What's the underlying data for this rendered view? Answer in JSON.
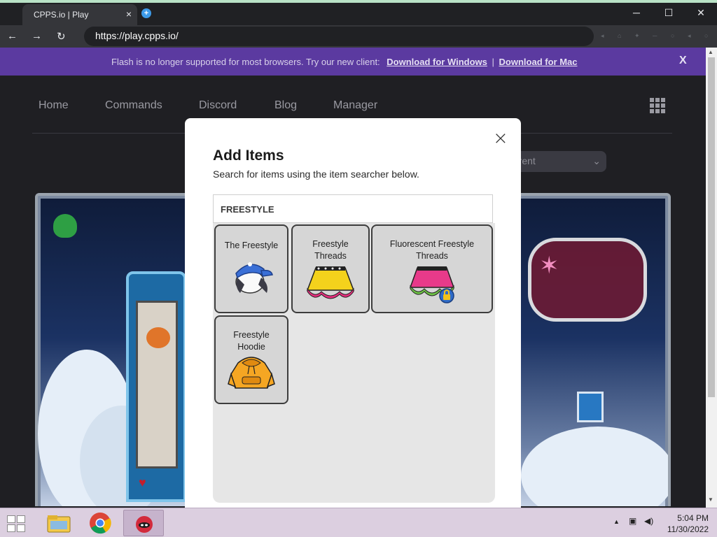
{
  "browser": {
    "tab_title": "CPPS.io | Play",
    "tab_close": "×",
    "new_tab": "+",
    "url": "https://play.cpps.io/",
    "back": "←",
    "forward": "→",
    "reload": "↻",
    "minimize": "─",
    "maximize": "☐",
    "close": "✕"
  },
  "flash_banner": {
    "text": "Flash is no longer supported for most browsers. Try our new client:",
    "download_windows": "Download for Windows",
    "separator": "|",
    "download_mac": "Download for Mac",
    "close": "X"
  },
  "nav": {
    "items": [
      "Home",
      "Commands",
      "Discord",
      "Blog",
      "Manager"
    ]
  },
  "server_select": {
    "value": "rrent",
    "chevron": "⌄"
  },
  "modal": {
    "close": "×",
    "title": "Add Items",
    "subtitle": "Search for items using the item searcher below.",
    "search_value": "FREESTYLE",
    "items": [
      {
        "label": "The Freestyle",
        "icon": "cap-hair-icon"
      },
      {
        "label": "Freestyle Threads",
        "icon": "yellow-skirt-icon"
      },
      {
        "label": "Fluorescent Freestyle Threads",
        "icon": "pink-skirt-lock-icon"
      },
      {
        "label": "Freestyle Hoodie",
        "icon": "orange-hoodie-icon"
      }
    ]
  },
  "taskbar": {
    "time": "5:04 PM",
    "date": "11/30/2022",
    "tray_arrow": "▲"
  },
  "colors": {
    "flash_banner": "#5b3aa0",
    "page_bg": "#1f1f23",
    "modal_bg": "#ffffff",
    "item_bg": "#d6d6d6"
  }
}
